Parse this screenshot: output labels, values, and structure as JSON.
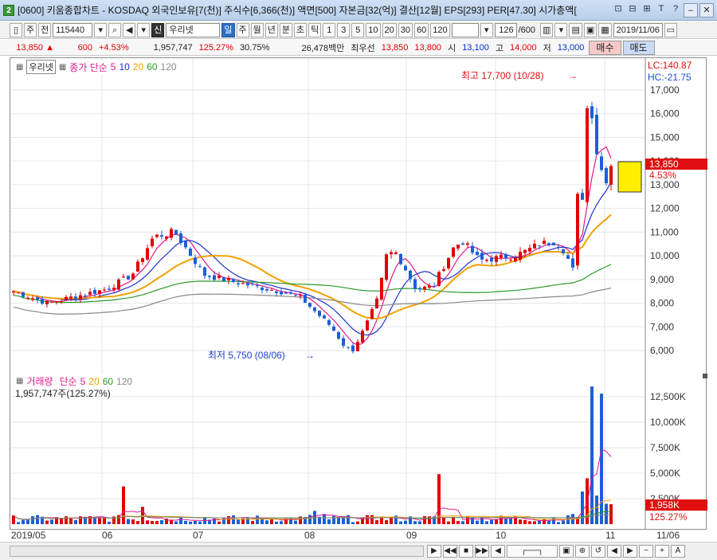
{
  "window": {
    "badge": "2",
    "title": "[0600] 키움종합차트 - KOSDAQ 외국인보유[7(천)] 주식수[6,366(천)] 액면[500] 자본금[32(억)] 결산[12월] EPS[293] PER[47.30] 시가총액[",
    "close_label": "✕",
    "minimize_label": "–",
    "tool_icons": [
      "⊡",
      "⊡",
      "⊡",
      "T",
      "?"
    ]
  },
  "toolbar": {
    "period_label": "주",
    "prev_label": "전",
    "code": "115440",
    "stock_name": "우리넷",
    "stock_tag": "신",
    "intervals": [
      "일",
      "주",
      "월",
      "년",
      "분",
      "초",
      "틱"
    ],
    "active_interval": "일",
    "ticks": [
      "1",
      "3",
      "5",
      "10",
      "20",
      "30",
      "60",
      "120"
    ],
    "count": "126",
    "count_total": "/600",
    "date": "2019/11/06"
  },
  "quote": {
    "price": "13,850",
    "change": "600",
    "change_pct": "+4.53%",
    "volume": "1,957,747",
    "vol_ratio": "125.27%",
    "turnover": "30.75%",
    "amount": "26,478백만",
    "best_ask_label": "최우선",
    "ask": "13,850",
    "bid": "13,800",
    "open_label": "시",
    "open": "13,100",
    "high_label": "고",
    "high": "14,000",
    "low_label": "저",
    "low": "13,000",
    "buy_label": "매수",
    "sell_label": "매도"
  },
  "price_panel": {
    "stock_label": "우리넷",
    "ma_title": "종가 단순",
    "ma_periods": [
      "5",
      "10",
      "20",
      "60",
      "120"
    ],
    "ma_colors": [
      "#e0198c",
      "#2233cc",
      "#f2a100",
      "#2a9a2a",
      "#888888"
    ],
    "lc": "LC:140.87",
    "hc": "HC:-21.75",
    "y_ticks": [
      "17,000",
      "16,000",
      "15,000",
      "14,000",
      "13,000",
      "12,000",
      "11,000",
      "10,000",
      "9,000",
      "8,000",
      "7,000",
      "6,000"
    ],
    "last_price": "13,850",
    "last_pct": "4.53%",
    "high_note": "최고 17,700 (10/28)",
    "low_note": "최저 5,750 (08/06)"
  },
  "volume_panel": {
    "title": "거래량",
    "ma_title": "단순",
    "ma_periods": [
      "5",
      "20",
      "60",
      "120"
    ],
    "ma_colors": [
      "#e0198c",
      "#f2a100",
      "#2a9a2a",
      "#888888"
    ],
    "summary": "1,957,747주(125.27%)",
    "y_ticks": [
      "12,500K",
      "10,000K",
      "7,500K",
      "5,000K",
      "2,500K"
    ],
    "last_vol": "1,958K",
    "last_pct": "125.27%"
  },
  "x_axis": {
    "labels": [
      "2019/05",
      "06",
      "07",
      "08",
      "09",
      "10",
      "11",
      "11/06"
    ]
  },
  "colors": {
    "up": "#e00000",
    "down": "#1a5fd6"
  }
}
